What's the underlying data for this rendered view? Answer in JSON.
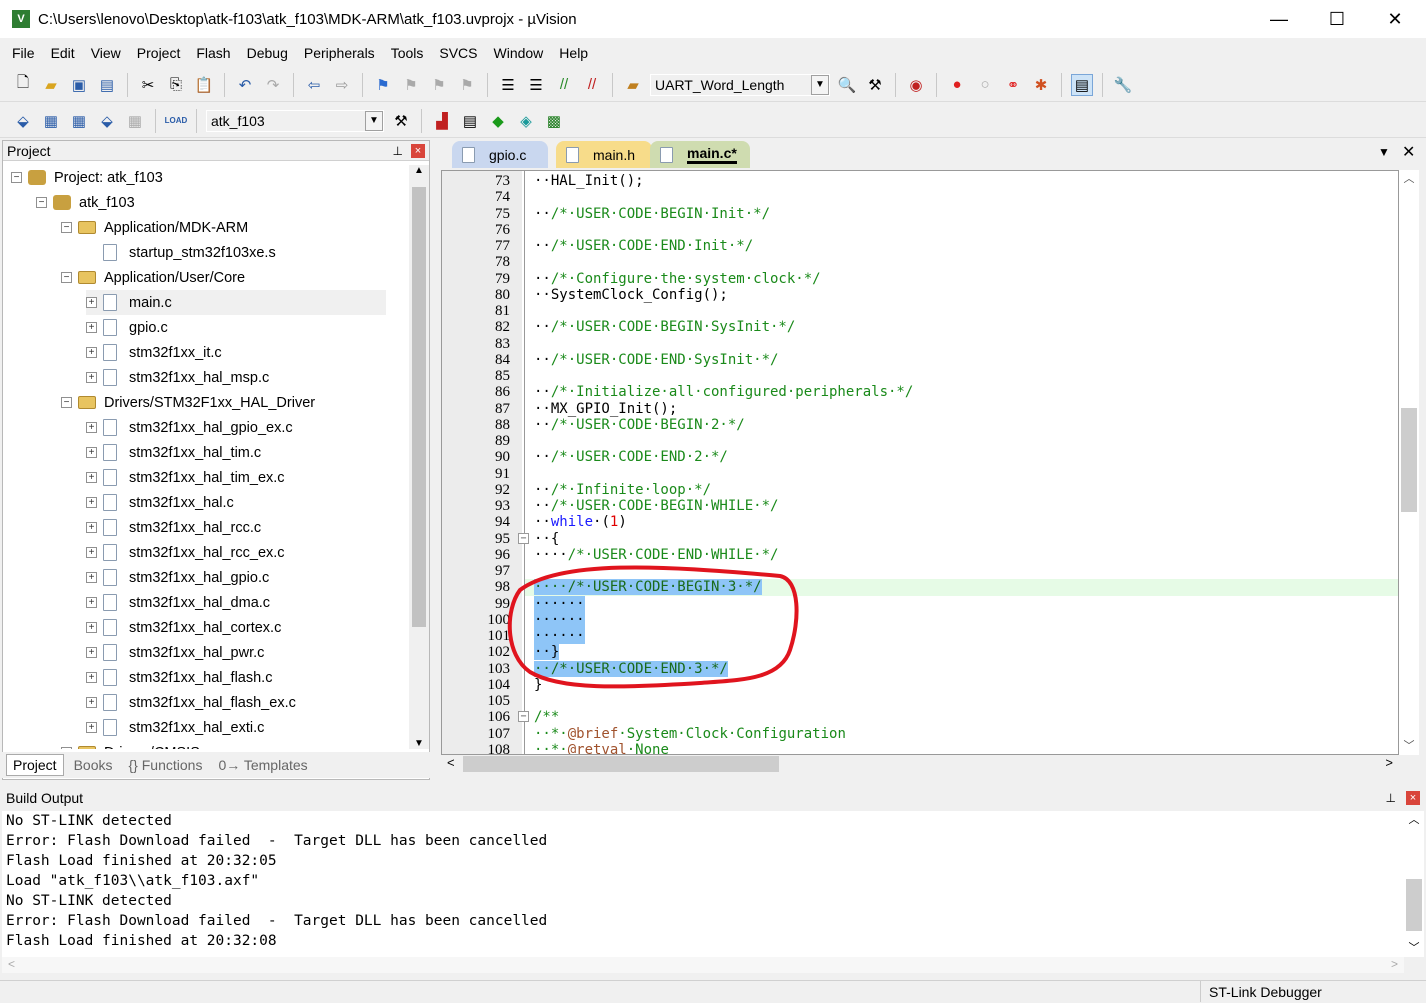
{
  "window": {
    "title": "C:\\Users\\lenovo\\Desktop\\atk-f103\\atk_f103\\MDK-ARM\\atk_f103.uvprojx - µVision",
    "logo": "V",
    "minimize": "—",
    "maximize": "☐",
    "close": "✕"
  },
  "menu": [
    "File",
    "Edit",
    "View",
    "Project",
    "Flash",
    "Debug",
    "Peripherals",
    "Tools",
    "SVCS",
    "Window",
    "Help"
  ],
  "toolbar1": {
    "find_combo": "UART_Word_Length"
  },
  "toolbar2": {
    "target_combo": "atk_f103",
    "load_label": "LOAD"
  },
  "project_panel": {
    "title": "Project",
    "pin": "📌",
    "close": "×",
    "tree": [
      {
        "label": "Project: atk_f103",
        "level": 0,
        "kind": "root",
        "exp": "−"
      },
      {
        "label": "atk_f103",
        "level": 1,
        "kind": "target",
        "exp": "−"
      },
      {
        "label": "Application/MDK-ARM",
        "level": 2,
        "kind": "folder",
        "exp": "−"
      },
      {
        "label": "startup_stm32f103xe.s",
        "level": 3,
        "kind": "file",
        "exp": ""
      },
      {
        "label": "Application/User/Core",
        "level": 2,
        "kind": "folder",
        "exp": "−"
      },
      {
        "label": "main.c",
        "level": 3,
        "kind": "file",
        "exp": "+",
        "selected": true
      },
      {
        "label": "gpio.c",
        "level": 3,
        "kind": "file",
        "exp": "+"
      },
      {
        "label": "stm32f1xx_it.c",
        "level": 3,
        "kind": "file",
        "exp": "+"
      },
      {
        "label": "stm32f1xx_hal_msp.c",
        "level": 3,
        "kind": "file",
        "exp": "+"
      },
      {
        "label": "Drivers/STM32F1xx_HAL_Driver",
        "level": 2,
        "kind": "folder",
        "exp": "−"
      },
      {
        "label": "stm32f1xx_hal_gpio_ex.c",
        "level": 3,
        "kind": "file",
        "exp": "+"
      },
      {
        "label": "stm32f1xx_hal_tim.c",
        "level": 3,
        "kind": "file",
        "exp": "+"
      },
      {
        "label": "stm32f1xx_hal_tim_ex.c",
        "level": 3,
        "kind": "file",
        "exp": "+"
      },
      {
        "label": "stm32f1xx_hal.c",
        "level": 3,
        "kind": "file",
        "exp": "+"
      },
      {
        "label": "stm32f1xx_hal_rcc.c",
        "level": 3,
        "kind": "file",
        "exp": "+"
      },
      {
        "label": "stm32f1xx_hal_rcc_ex.c",
        "level": 3,
        "kind": "file",
        "exp": "+"
      },
      {
        "label": "stm32f1xx_hal_gpio.c",
        "level": 3,
        "kind": "file",
        "exp": "+"
      },
      {
        "label": "stm32f1xx_hal_dma.c",
        "level": 3,
        "kind": "file",
        "exp": "+"
      },
      {
        "label": "stm32f1xx_hal_cortex.c",
        "level": 3,
        "kind": "file",
        "exp": "+"
      },
      {
        "label": "stm32f1xx_hal_pwr.c",
        "level": 3,
        "kind": "file",
        "exp": "+"
      },
      {
        "label": "stm32f1xx_hal_flash.c",
        "level": 3,
        "kind": "file",
        "exp": "+"
      },
      {
        "label": "stm32f1xx_hal_flash_ex.c",
        "level": 3,
        "kind": "file",
        "exp": "+"
      },
      {
        "label": "stm32f1xx_hal_exti.c",
        "level": 3,
        "kind": "file",
        "exp": "+"
      },
      {
        "label": "Drivers/CMSIS",
        "level": 2,
        "kind": "folder",
        "exp": "−"
      }
    ],
    "tabs": [
      {
        "label": "Project",
        "active": true
      },
      {
        "label": "Books"
      },
      {
        "label": "{} Functions"
      },
      {
        "label": "0→ Templates"
      }
    ]
  },
  "editor": {
    "tabs": [
      {
        "label": "gpio.c",
        "color": "#c9d7ef"
      },
      {
        "label": "main.h",
        "color": "#f7dc8a"
      },
      {
        "label": "main.c*",
        "color": "#cfdcb0",
        "active": true
      }
    ],
    "lines": [
      {
        "n": "73",
        "segs": [
          {
            "t": "··HAL_Init();"
          }
        ]
      },
      {
        "n": "74",
        "segs": []
      },
      {
        "n": "75",
        "segs": [
          {
            "t": "··"
          },
          {
            "t": "/*·USER·CODE·BEGIN·Init·*/",
            "c": "cm"
          }
        ]
      },
      {
        "n": "76",
        "segs": []
      },
      {
        "n": "77",
        "segs": [
          {
            "t": "··"
          },
          {
            "t": "/*·USER·CODE·END·Init·*/",
            "c": "cm"
          }
        ]
      },
      {
        "n": "78",
        "segs": []
      },
      {
        "n": "79",
        "segs": [
          {
            "t": "··"
          },
          {
            "t": "/*·Configure·the·system·clock·*/",
            "c": "cm"
          }
        ]
      },
      {
        "n": "80",
        "segs": [
          {
            "t": "··SystemClock_Config();"
          }
        ]
      },
      {
        "n": "81",
        "segs": []
      },
      {
        "n": "82",
        "segs": [
          {
            "t": "··"
          },
          {
            "t": "/*·USER·CODE·BEGIN·SysInit·*/",
            "c": "cm"
          }
        ]
      },
      {
        "n": "83",
        "segs": []
      },
      {
        "n": "84",
        "segs": [
          {
            "t": "··"
          },
          {
            "t": "/*·USER·CODE·END·SysInit·*/",
            "c": "cm"
          }
        ]
      },
      {
        "n": "85",
        "segs": []
      },
      {
        "n": "86",
        "segs": [
          {
            "t": "··"
          },
          {
            "t": "/*·Initialize·all·configured·peripherals·*/",
            "c": "cm"
          }
        ]
      },
      {
        "n": "87",
        "segs": [
          {
            "t": "··MX_GPIO_Init();"
          }
        ]
      },
      {
        "n": "88",
        "segs": [
          {
            "t": "··"
          },
          {
            "t": "/*·USER·CODE·BEGIN·2·*/",
            "c": "cm"
          }
        ]
      },
      {
        "n": "89",
        "segs": []
      },
      {
        "n": "90",
        "segs": [
          {
            "t": "··"
          },
          {
            "t": "/*·USER·CODE·END·2·*/",
            "c": "cm"
          }
        ]
      },
      {
        "n": "91",
        "segs": []
      },
      {
        "n": "92",
        "segs": [
          {
            "t": "··"
          },
          {
            "t": "/*·Infinite·loop·*/",
            "c": "cm"
          }
        ]
      },
      {
        "n": "93",
        "segs": [
          {
            "t": "··"
          },
          {
            "t": "/*·USER·CODE·BEGIN·WHILE·*/",
            "c": "cm"
          }
        ]
      },
      {
        "n": "94",
        "segs": [
          {
            "t": "··"
          },
          {
            "t": "while",
            "c": "kw"
          },
          {
            "t": "·("
          },
          {
            "t": "1",
            "c": "num"
          },
          {
            "t": ")"
          }
        ]
      },
      {
        "n": "95",
        "fold": "−",
        "segs": [
          {
            "t": "··{"
          }
        ]
      },
      {
        "n": "96",
        "segs": [
          {
            "t": "····"
          },
          {
            "t": "/*·USER·CODE·END·WHILE·*/",
            "c": "cm"
          }
        ]
      },
      {
        "n": "97",
        "segs": []
      },
      {
        "n": "98",
        "current": true,
        "segs": [
          {
            "t": "····/*·USER·CODE·BEGIN·3·*/",
            "c": "hl"
          }
        ]
      },
      {
        "n": "99",
        "segs": [
          {
            "t": "······",
            "c": "hl"
          }
        ]
      },
      {
        "n": "100",
        "segs": [
          {
            "t": "······",
            "c": "hl"
          }
        ]
      },
      {
        "n": "101",
        "segs": [
          {
            "t": "······",
            "c": "hl"
          }
        ]
      },
      {
        "n": "102",
        "segs": [
          {
            "t": "··}",
            "c": "hl"
          }
        ]
      },
      {
        "n": "103",
        "segs": [
          {
            "t": "··/*·USER·CODE·END·3·*/",
            "c": "hl"
          }
        ]
      },
      {
        "n": "104",
        "segs": [
          {
            "t": "}"
          }
        ]
      },
      {
        "n": "105",
        "segs": []
      },
      {
        "n": "106",
        "fold": "−",
        "segs": [
          {
            "t": "/**",
            "c": "cm"
          }
        ]
      },
      {
        "n": "107",
        "segs": [
          {
            "t": "··*·",
            "c": "cm"
          },
          {
            "t": "@brief",
            "c": "at"
          },
          {
            "t": "·System·Clock·Configuration",
            "c": "cm"
          }
        ]
      },
      {
        "n": "108",
        "segs": [
          {
            "t": "··*·",
            "c": "cm"
          },
          {
            "t": "@retval",
            "c": "at"
          },
          {
            "t": "·None",
            "c": "cm"
          }
        ]
      }
    ]
  },
  "build_output": {
    "title": "Build Output",
    "lines": [
      "No ST-LINK detected",
      "Error: Flash Download failed  -  Target DLL has been cancelled",
      "Flash Load finished at 20:32:05",
      "Load \"atk_f103\\\\atk_f103.axf\"",
      "No ST-LINK detected",
      "Error: Flash Download failed  -  Target DLL has been cancelled",
      "Flash Load finished at 20:32:08"
    ]
  },
  "status_bar": {
    "debugger": "ST-Link Debugger"
  },
  "colors": {
    "annotation_red": "#e0141e",
    "selection": "#8ec5f7",
    "comment": "#1a8a1a",
    "keyword": "#1a1aff"
  }
}
